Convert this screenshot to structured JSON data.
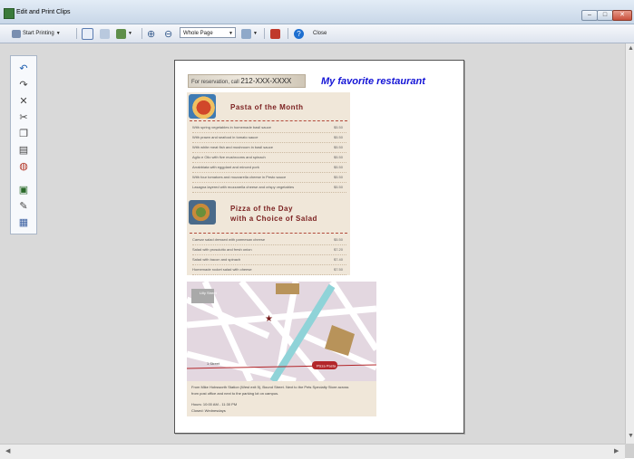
{
  "window": {
    "title": "Edit and Print Clips"
  },
  "toolbar": {
    "start_printing": "Start Printing",
    "zoom": "Whole Page",
    "close": "Close"
  },
  "clip": {
    "reservation_label": "For reservation, call",
    "phone": "212-XXX-XXXX",
    "heading": "My favorite restaurant",
    "pasta": {
      "title": "Pasta of the Month",
      "items": [
        {
          "name": "With spring vegetables in homemade basil sauce",
          "price": "$5.50"
        },
        {
          "name": "With prawn and seafood in tomato sauce",
          "price": "$5.50"
        },
        {
          "name": "With white meat fish and mushroom in basil sauce",
          "price": "$5.50"
        },
        {
          "name": "Aglio e Olio with five mushrooms and spinach",
          "price": "$5.50"
        },
        {
          "name": "Arrabbiata with eggplant and minced pork",
          "price": "$5.50"
        },
        {
          "name": "With four tomatoes and mozzarella cheese in Pesto sauce",
          "price": "$5.50"
        },
        {
          "name": "Lasagna layered with mozzarella cheese and crispy vegetables",
          "price": "$5.50"
        }
      ]
    },
    "pizza": {
      "title_line1": "Pizza of the Day",
      "title_line2": "with a Choice of Salad",
      "items": [
        {
          "name": "Caesar salad dressed with parmesan cheese",
          "price": "$5.50"
        },
        {
          "name": "Salad with prosciutto and fresh onion",
          "price": "$7.20"
        },
        {
          "name": "Salad with bacon and spinach",
          "price": "$7.40"
        },
        {
          "name": "Homemade rocket salad with cheese",
          "price": "$7.50"
        }
      ]
    },
    "map": {
      "street_label": "Lilly Street",
      "avenue_label": "1 Street",
      "badge": "Pizza Pasta",
      "directions_1": "From Mike Hobsworth Station (West exit 5), Bound Street. Next to the Pets Specialty Store across",
      "directions_2": "from post office and next to the parking lot on campus.",
      "hours_1": "Hours: 10:00 AM - 11:30 PM",
      "hours_2": "Closed: Wednesdays"
    }
  },
  "colors": {
    "heading_blue": "#1414d6",
    "menu_bg": "#f0e7d9",
    "section_red": "#7a1e1e",
    "badge_red": "#b3262a"
  }
}
